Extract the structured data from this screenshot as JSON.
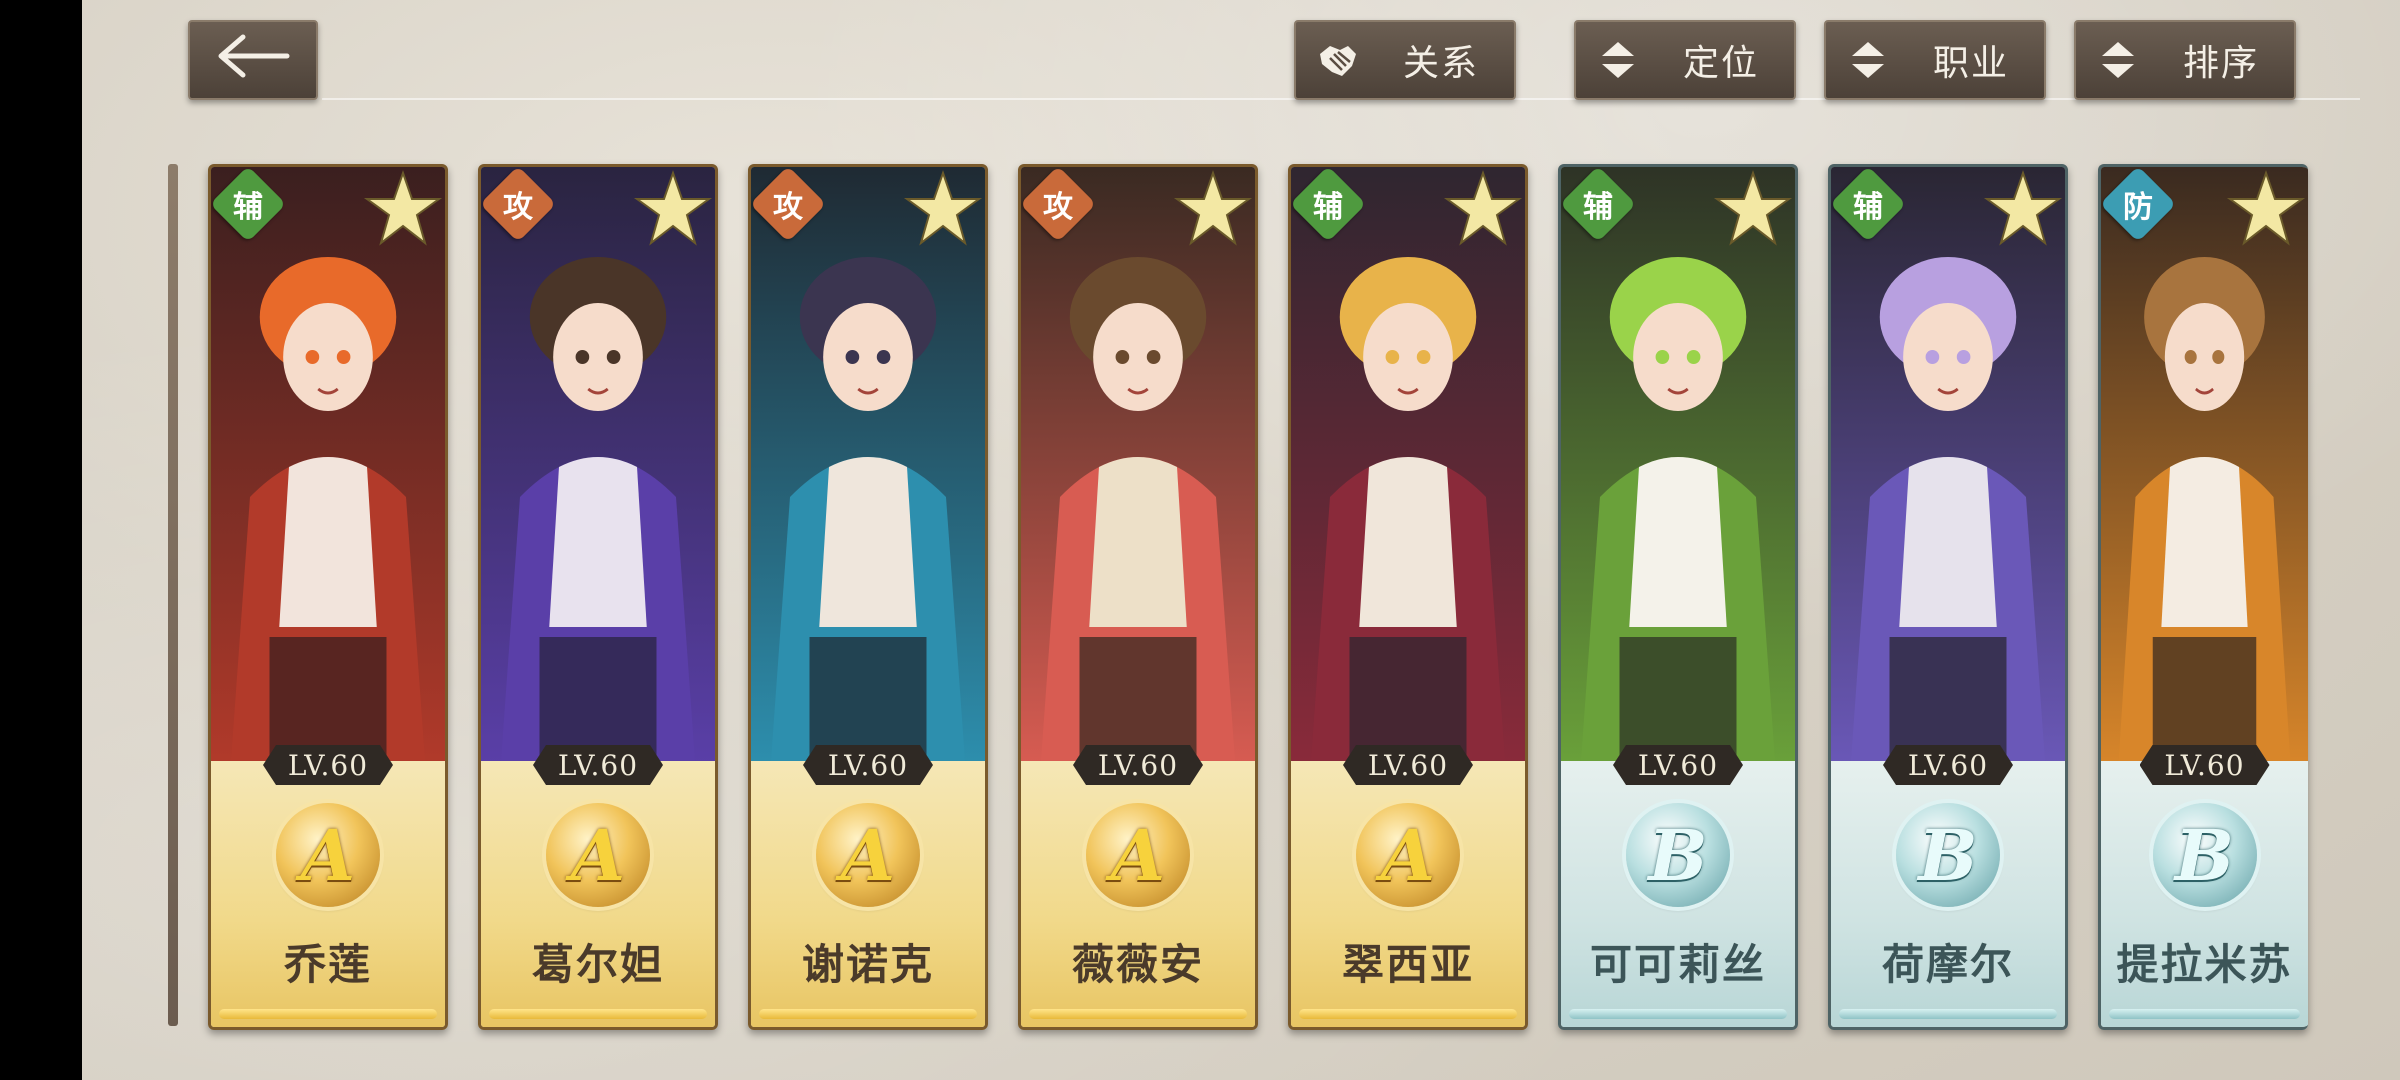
{
  "toolbar": {
    "back_icon": "arrow-left-icon",
    "buttons": [
      {
        "label": "关系",
        "icon": "handshake-icon"
      },
      {
        "label": "定位",
        "icon": "sort-arrows-icon"
      },
      {
        "label": "职业",
        "icon": "sort-arrows-icon"
      },
      {
        "label": "排序",
        "icon": "sort-arrows-icon"
      }
    ]
  },
  "colors": {
    "role_support": "#4f9a3f",
    "role_attack": "#c96a3a",
    "role_defense": "#3c9db3",
    "rank_a": "#f1c45a",
    "rank_b": "#b9dfe0"
  },
  "characters": [
    {
      "name": "乔莲",
      "role": "辅",
      "level": "LV.60",
      "rank": "A"
    },
    {
      "name": "葛尔妲",
      "role": "攻",
      "level": "LV.60",
      "rank": "A"
    },
    {
      "name": "谢诺克",
      "role": "攻",
      "level": "LV.60",
      "rank": "A"
    },
    {
      "name": "薇薇安",
      "role": "攻",
      "level": "LV.60",
      "rank": "A"
    },
    {
      "name": "翠西亚",
      "role": "辅",
      "level": "LV.60",
      "rank": "A"
    },
    {
      "name": "可可莉丝",
      "role": "辅",
      "level": "LV.60",
      "rank": "B"
    },
    {
      "name": "荷摩尔",
      "role": "辅",
      "level": "LV.60",
      "rank": "B"
    },
    {
      "name": "提拉米苏",
      "role": "防",
      "level": "LV.60",
      "rank": "B"
    }
  ]
}
